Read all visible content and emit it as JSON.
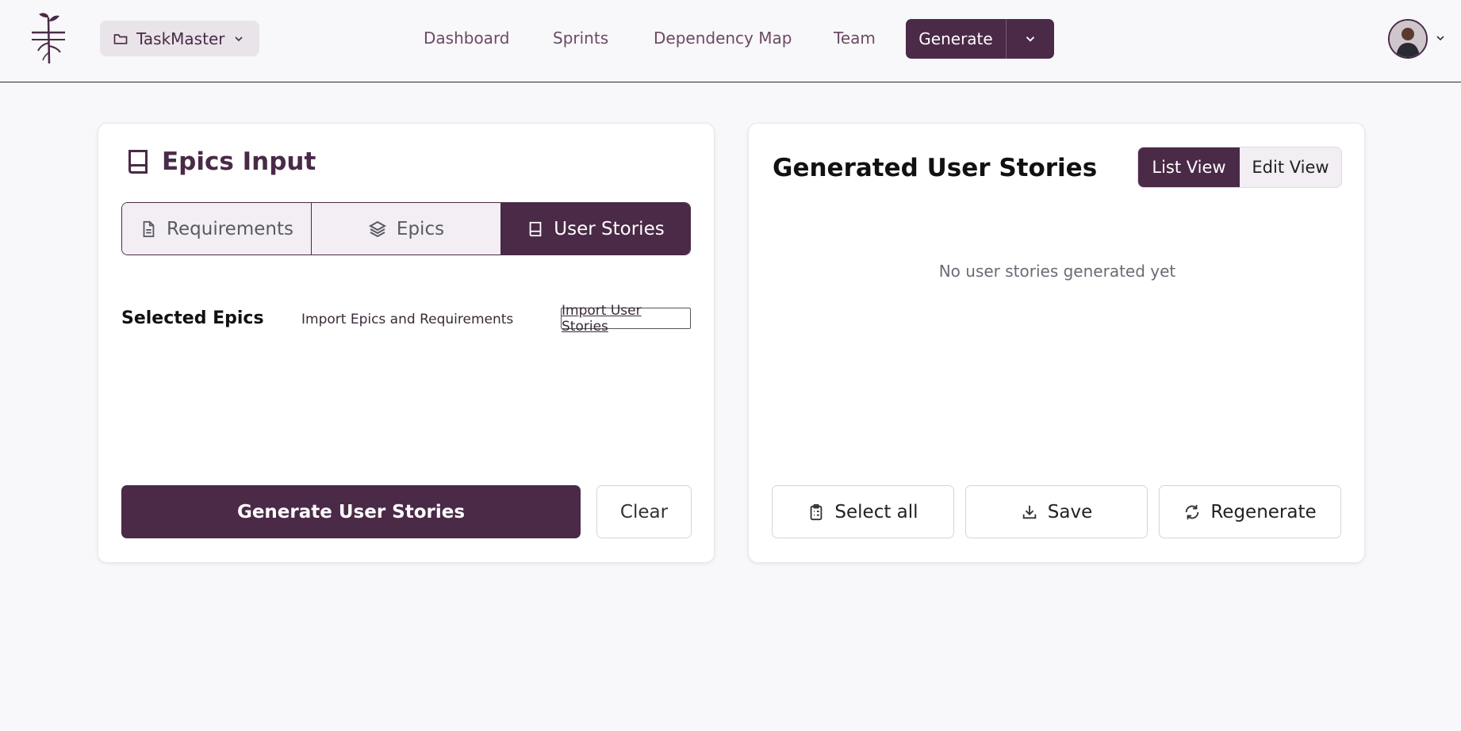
{
  "header": {
    "project_name": "TaskMaster",
    "nav": [
      "Dashboard",
      "Sprints",
      "Dependency Map",
      "Team"
    ],
    "generate_label": "Generate"
  },
  "left_panel": {
    "title": "Epics Input",
    "tabs": [
      {
        "label": "Requirements",
        "icon": "file-text-icon"
      },
      {
        "label": "Epics",
        "icon": "layers-icon"
      },
      {
        "label": "User Stories",
        "icon": "book-icon",
        "active": true
      }
    ],
    "selected_label": "Selected Epics",
    "import_epics_label": "Import Epics and Requirements",
    "import_stories_label": "Import User Stories",
    "generate_button": "Generate User Stories",
    "clear_button": "Clear"
  },
  "right_panel": {
    "title": "Generated User Stories",
    "views": [
      "List View",
      "Edit View"
    ],
    "active_view": "List View",
    "empty_message": "No user stories generated yet",
    "actions": [
      {
        "label": "Select all",
        "icon": "clipboard-list-icon"
      },
      {
        "label": "Save",
        "icon": "download-icon"
      },
      {
        "label": "Regenerate",
        "icon": "refresh-icon"
      }
    ]
  },
  "colors": {
    "brand": "#4a2a47",
    "background": "#f8f7f9"
  }
}
